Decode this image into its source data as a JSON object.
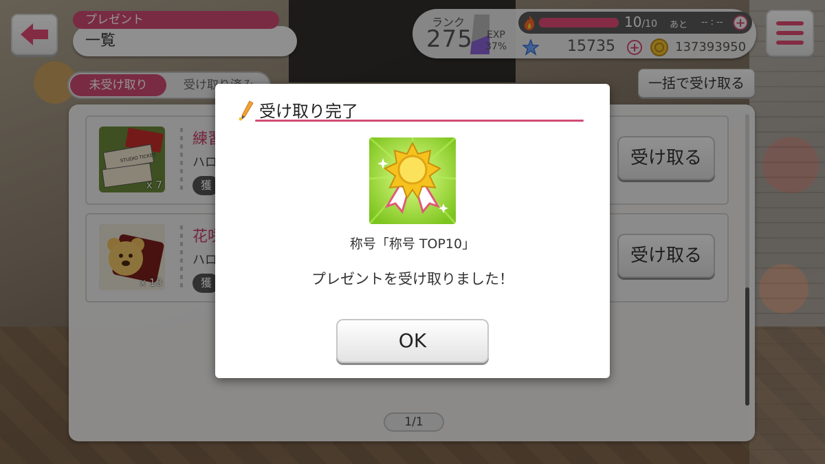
{
  "header": {
    "category_label": "プレゼント",
    "title": "一覧"
  },
  "status": {
    "rank_label": "ランク",
    "rank_value": "275",
    "exp_label": "EXP",
    "exp_percent": "37%",
    "stamina_value": "10",
    "stamina_max": "/10",
    "stamina_fraction": 1.0,
    "stamina_until_label": "あと",
    "stamina_timer": "-- : --",
    "star_count": "15735",
    "coin_count": "137393950"
  },
  "tabs": {
    "unreceived": "未受け取り",
    "received": "受け取り済み"
  },
  "bulk_receive_label": "一括で受け取る",
  "items": [
    {
      "name": "練習",
      "sub": "ハロ",
      "chip": "獲",
      "count": "x 7",
      "thumb_text": "STUDIO TICKET",
      "button": "受け取る"
    },
    {
      "name": "花咲",
      "sub": "ハロ",
      "chip": "獲",
      "count": "x 10",
      "button": "受け取る"
    }
  ],
  "pager": "1/1",
  "modal": {
    "title": "受け取り完了",
    "reward_name": "称号「称号 TOP10」",
    "message": "プレゼントを受け取りました！",
    "ok_label": "OK"
  },
  "colors": {
    "accent": "#d14b74",
    "reward_bg": "#8fd42a",
    "medal": "#f2c12e"
  }
}
